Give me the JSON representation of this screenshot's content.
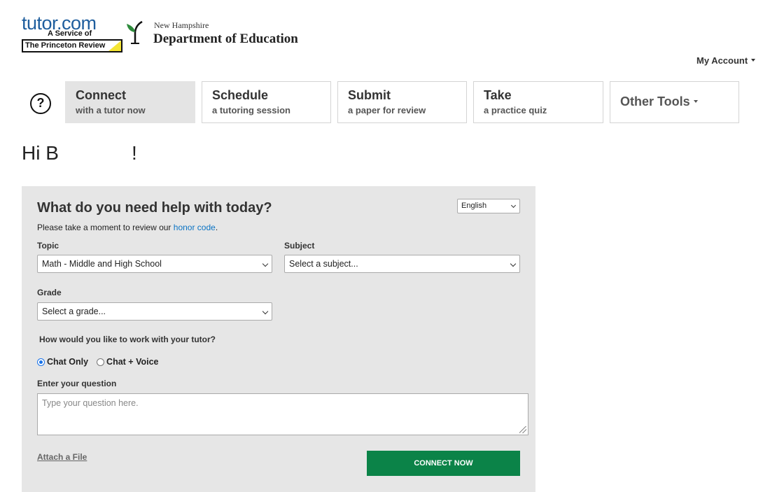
{
  "header": {
    "logo": {
      "brand": "tutor.com",
      "service": "A Service of",
      "partner": "The Princeton Review"
    },
    "org": {
      "state": "New Hampshire",
      "department": "Department of Education"
    },
    "account_label": "My Account"
  },
  "nav": {
    "help_icon": "question-circle-icon",
    "tabs": [
      {
        "title": "Connect",
        "subtitle": "with a tutor now",
        "active": true
      },
      {
        "title": "Schedule",
        "subtitle": "a tutoring session",
        "active": false
      },
      {
        "title": "Submit",
        "subtitle": "a paper for review",
        "active": false
      },
      {
        "title": "Take",
        "subtitle": "a practice quiz",
        "active": false
      },
      {
        "title": "Other Tools",
        "subtitle": "",
        "active": false
      }
    ]
  },
  "greeting": {
    "text": "Hi B",
    "suffix": "!"
  },
  "form": {
    "title": "What do you need help with today?",
    "language": "English",
    "intro_text": "Please take a moment to review our ",
    "intro_link": "honor code",
    "intro_end": ".",
    "topic_label": "Topic",
    "topic_value": "Math - Middle and High School",
    "subject_label": "Subject",
    "subject_value": "Select a subject...",
    "grade_label": "Grade",
    "grade_value": "Select a grade...",
    "mode_label": "How would you like to work with your tutor?",
    "modes": [
      {
        "label": "Chat Only",
        "checked": true
      },
      {
        "label": "Chat + Voice",
        "checked": false
      }
    ],
    "question_label": "Enter your question",
    "question_placeholder": "Type your question here.",
    "attach_label": "Attach a File",
    "connect_label": "CONNECT NOW"
  },
  "colors": {
    "brand_blue": "#1f5e9e",
    "button_green": "#0b8348",
    "link_blue": "#0a73c4",
    "panel_bg": "#e6e6e6"
  }
}
